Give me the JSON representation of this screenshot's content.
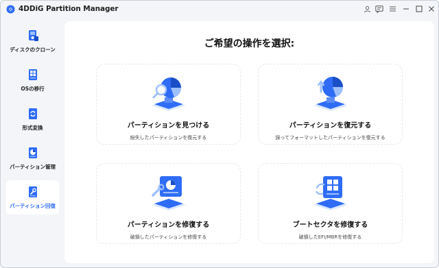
{
  "app": {
    "title": "4DDiG Partition Manager"
  },
  "titlebar": {
    "icons": [
      "user-icon",
      "feedback-icon",
      "menu-icon",
      "minimize-icon",
      "maximize-icon",
      "close-icon"
    ]
  },
  "sidebar": {
    "items": [
      {
        "label": "ディスクのクローン",
        "icon": "disk-clone-icon",
        "active": false
      },
      {
        "label": "OSの移行",
        "icon": "os-migrate-icon",
        "active": false
      },
      {
        "label": "形式変換",
        "icon": "convert-icon",
        "active": false
      },
      {
        "label": "パーティション管理",
        "icon": "partition-manage-icon",
        "active": false
      },
      {
        "label": "パーティション回復",
        "icon": "partition-recovery-icon",
        "active": true
      }
    ]
  },
  "main": {
    "title": "ご希望の操作を選択:",
    "cards": [
      {
        "title": "パーティションを見つける",
        "desc": "紛失したパーティションを復元する",
        "icon": "find-partition-icon"
      },
      {
        "title": "パーティションを復元する",
        "desc": "誤ってフォーマットしたパーティションを復元する",
        "icon": "restore-partition-icon"
      },
      {
        "title": "パーティションを修復する",
        "desc": "破損したパーティションを修復する",
        "icon": "repair-partition-icon"
      },
      {
        "title": "ブートセクタを修復する",
        "desc": "破損したEFI/MBRを修復する",
        "icon": "repair-bootsector-icon"
      }
    ]
  },
  "colors": {
    "accent": "#2f6cf6",
    "sidebar_bg": "#f3f5f8",
    "panel_bg": "#ffffff"
  }
}
